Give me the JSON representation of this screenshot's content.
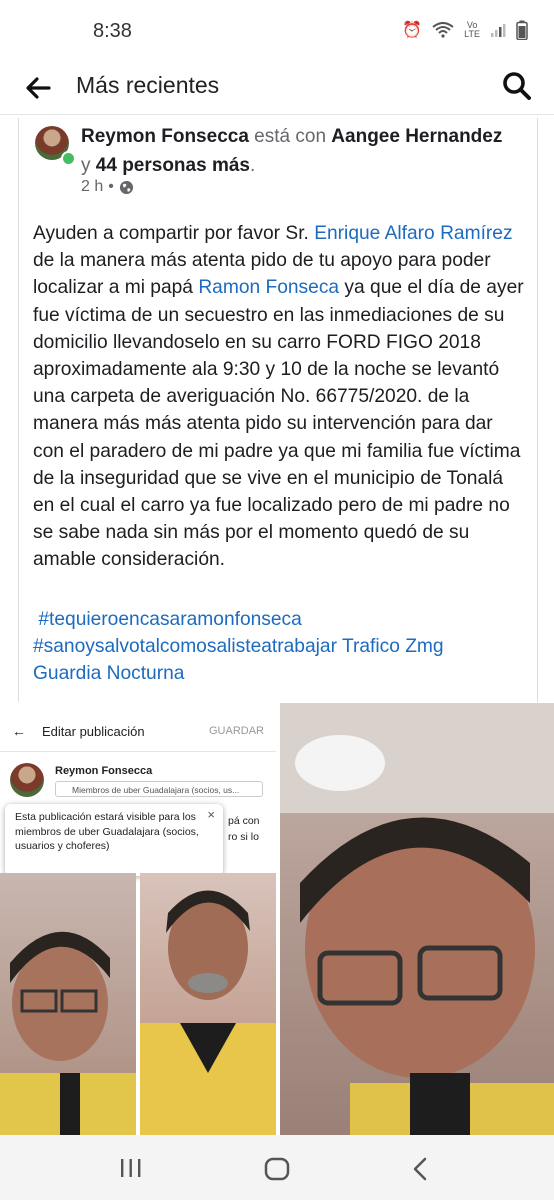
{
  "status": {
    "time": "8:38",
    "network_label_top": "Vo",
    "network_label_bottom": "LTE"
  },
  "app_bar": {
    "title": "Más recientes"
  },
  "post": {
    "author": "Reymon Fonsecca",
    "with_text": " está con ",
    "tagged": "Aangee Hernandez",
    "and_text": " y ",
    "others": "44 personas más",
    "end": ".",
    "time": "2 h",
    "sep": "•",
    "body": {
      "t1": "Ayuden a compartir por favor Sr. ",
      "m1": "Enrique Alfaro Ramírez",
      "t2": " de la manera más atenta pido de tu apoyo para poder localizar a mi papá ",
      "m2": "Ramon Fonseca",
      "t3": " ya que el día de ayer fue víctima de un secuestro en las inmediaciones de su domicilio llevandoselo en su carro  FORD FIGO 2018 aproximadamente ala 9:30 y 10 de la noche se levantó una carpeta de averiguación No. 66775/2020. de la manera más más atenta pido su intervención para dar con el paradero de mi padre ya que mi familia fue víctima de la inseguridad que se vive en el municipio de Tonalá en el cual el carro ya fue localizado pero de mi padre no se sabe nada sin más por el momento quedó de su amable consideración."
    },
    "hashtags": {
      "h1": "#tequieroencasaramonfonseca",
      "h2": "#sanoysalvotalcomosalisteatrabajar",
      "p1": "Trafico Zmg",
      "p2": "Guardia Nocturna"
    }
  },
  "embedded_screenshot": {
    "back": "←",
    "title": "Editar publicación",
    "save": "GUARDAR",
    "name": "Reymon Fonsecca",
    "audience": "Miembros de uber Guadalajara (socios, us...",
    "tooltip": "Esta publicación estará visible para los miembros de uber Guadalajara (socios, usuarios y choferes)",
    "close": "×",
    "peek_line1": "pá con",
    "peek_line2": "ro si lo"
  },
  "colors": {
    "link": "#1c6bbf",
    "online": "#45bd62",
    "muted": "#65676b"
  }
}
